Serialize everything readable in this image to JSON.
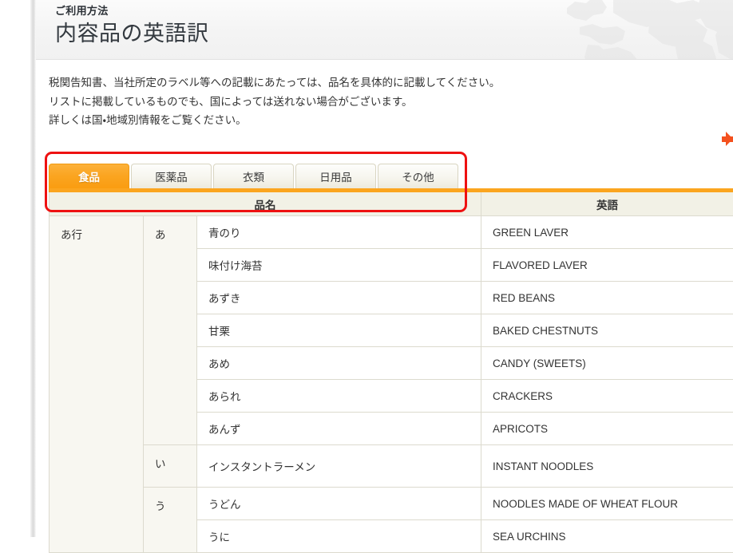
{
  "header": {
    "eyebrow": "ご利用方法",
    "title": "内容品の英語訳",
    "watermark_icon": "world-map-watermark"
  },
  "description": {
    "line1": "税関告知書、当社所定のラベル等への記載にあたっては、品名を具体的に記載してください。",
    "line2": "リストに掲載しているものでも、国によっては送れない場合がございます。",
    "line3": "詳しくは国・地域別情報をご覧ください。"
  },
  "side_arrow": {
    "icon": "right-arrow-tab-icon"
  },
  "tabs": [
    {
      "label": "食品",
      "active": true
    },
    {
      "label": "医薬品",
      "active": false
    },
    {
      "label": "衣類",
      "active": false
    },
    {
      "label": "日用品",
      "active": false
    },
    {
      "label": "その他",
      "active": false
    }
  ],
  "table": {
    "headers": {
      "name": "品名",
      "english": "英語"
    },
    "group": "あ行",
    "rows": [
      {
        "kana": "あ",
        "name": "青のり",
        "english": "GREEN LAVER"
      },
      {
        "kana": "",
        "name": "味付け海苔",
        "english": "FLAVORED LAVER"
      },
      {
        "kana": "",
        "name": "あずき",
        "english": "RED BEANS"
      },
      {
        "kana": "",
        "name": "甘栗",
        "english": "BAKED CHESTNUTS"
      },
      {
        "kana": "",
        "name": "あめ",
        "english": "CANDY (SWEETS)"
      },
      {
        "kana": "",
        "name": "あられ",
        "english": "CRACKERS"
      },
      {
        "kana": "",
        "name": "あんず",
        "english": "APRICOTS"
      },
      {
        "kana": "い",
        "name": "インスタントラーメン",
        "english": "INSTANT NOODLES"
      },
      {
        "kana": "う",
        "name": "うどん",
        "english": "NOODLES MADE OF WHEAT FLOUR"
      },
      {
        "kana": "",
        "name": "うに",
        "english": "SEA URCHINS"
      }
    ]
  },
  "colors": {
    "accent_orange": "#fba51f",
    "active_tab_orange": "#f99a0b",
    "annotation_red": "#ee1111",
    "side_arrow_orange": "#f4511e",
    "table_header_bg": "#f2f1e6",
    "table_border": "#dcdace",
    "group_cell_bg": "#f8f7f1"
  }
}
